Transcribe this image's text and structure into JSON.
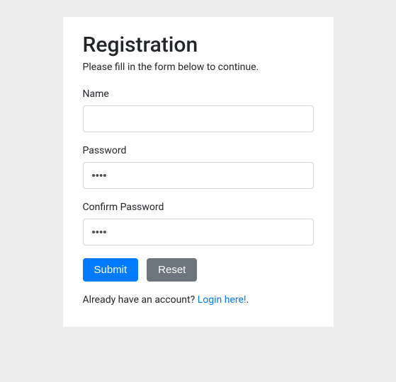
{
  "title": "Registration",
  "subtitle": "Please fill in the form below to continue.",
  "fields": {
    "name": {
      "label": "Name",
      "value": ""
    },
    "password": {
      "label": "Password",
      "value": "1234"
    },
    "confirm_password": {
      "label": "Confirm Password",
      "value": "1234"
    }
  },
  "buttons": {
    "submit": "Submit",
    "reset": "Reset"
  },
  "footer": {
    "text": "Already have an account? ",
    "link": "Login here!",
    "suffix": "."
  }
}
